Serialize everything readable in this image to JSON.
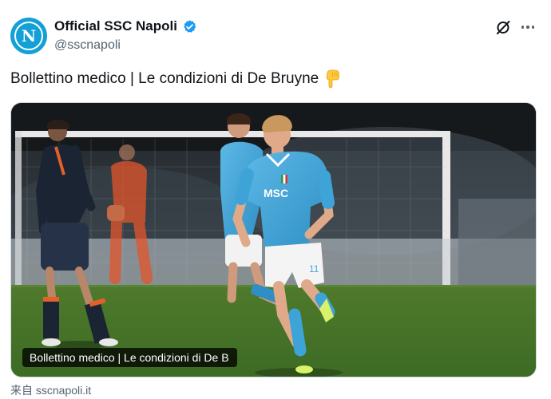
{
  "author": {
    "display_name": "Official SSC Napoli",
    "handle": "@sscnapoli",
    "avatar_letter": "N",
    "avatar_color": "#12a0d7",
    "verified_color": "#1d9bf0"
  },
  "tweet": {
    "text": "Bollettino medico | Le condizioni di De Bruyne",
    "emoji": "backhand-index-pointing-down"
  },
  "media": {
    "caption": "Bollettino medico | Le condizioni di De B",
    "kit_color": "#4aa9d8",
    "shirt_sponsor": "MSC",
    "shirt_number": "11"
  },
  "link_card": {
    "source_text": "来自 sscnapoli.it"
  },
  "actions": {
    "grok_icon": "grok-icon",
    "more_icon": "more-icon"
  }
}
